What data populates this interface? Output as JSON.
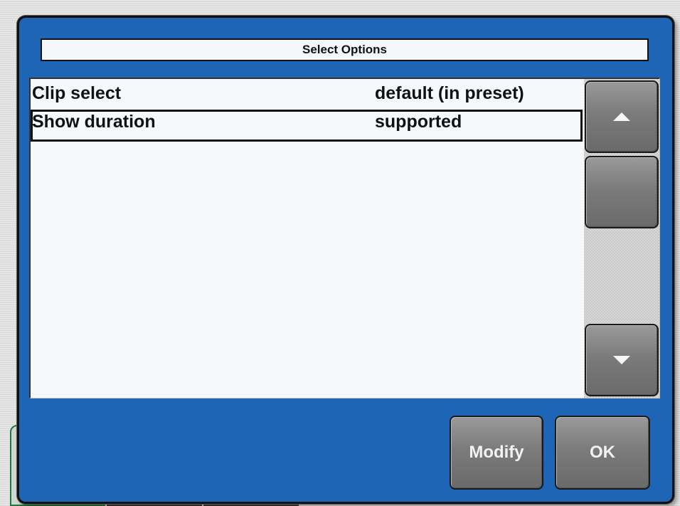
{
  "dialog": {
    "title": "Select Options"
  },
  "options": [
    {
      "name": "Clip select",
      "value": "default (in preset)",
      "selected": false
    },
    {
      "name": "Show duration",
      "value": "supported",
      "selected": true
    }
  ],
  "scrollbar": {
    "up_icon": "arrow-up-icon",
    "down_icon": "arrow-down-icon"
  },
  "buttons": {
    "modify_label": "Modify",
    "ok_label": "OK"
  },
  "colors": {
    "dialog_blue": "#1f65b5",
    "list_bg": "#f6f9fb",
    "button_gray": "#7b7b7b"
  }
}
